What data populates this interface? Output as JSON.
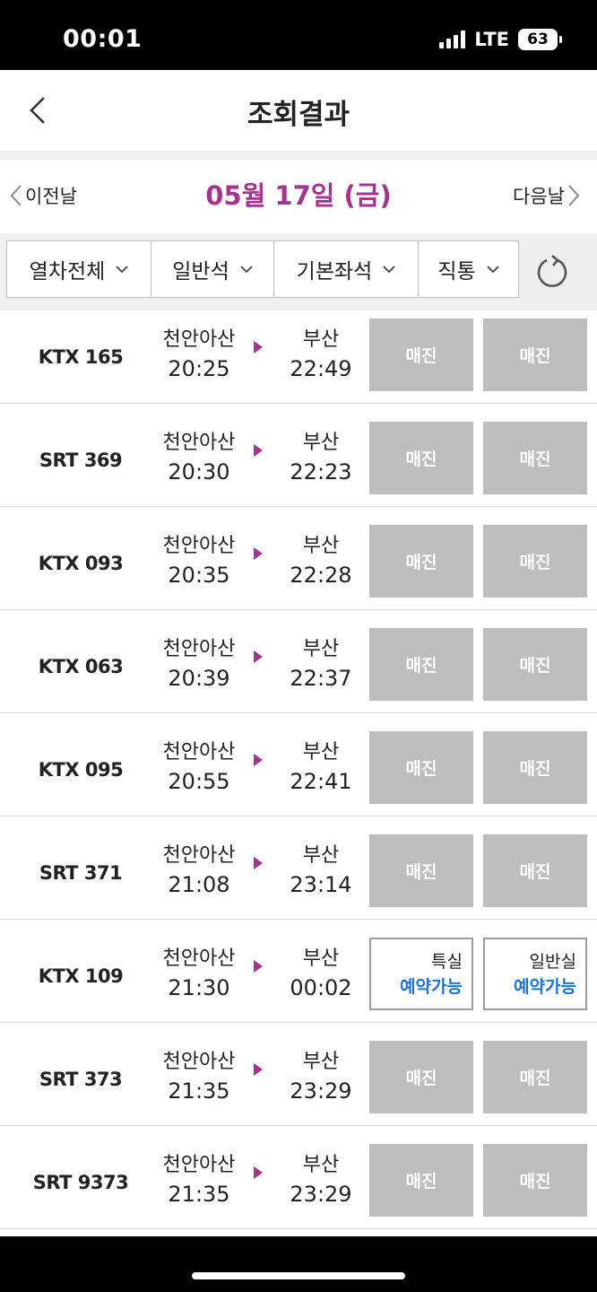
{
  "status": {
    "time": "00:01",
    "network": "LTE",
    "battery": "63"
  },
  "header": {
    "title": "조회결과",
    "back_icon": "chevron-left-icon"
  },
  "date_nav": {
    "prev_label": "이전날",
    "current_date": "05월 17일 (금)",
    "next_label": "다음날"
  },
  "filters": [
    {
      "label": "열차전체"
    },
    {
      "label": "일반석"
    },
    {
      "label": "기본좌석"
    },
    {
      "label": "직통"
    }
  ],
  "colors": {
    "accent": "#a3358f",
    "available": "#1a73d9",
    "soldout": "#bdbdbd"
  },
  "trains": [
    {
      "no": "KTX 165",
      "dep": "천안아산",
      "dep_time": "20:25",
      "arr": "부산",
      "arr_time": "22:49",
      "seat1": {
        "label": "매진",
        "status": "soldout"
      },
      "seat2": {
        "label": "매진",
        "status": "soldout"
      }
    },
    {
      "no": "SRT 369",
      "dep": "천안아산",
      "dep_time": "20:30",
      "arr": "부산",
      "arr_time": "22:23",
      "seat1": {
        "label": "매진",
        "status": "soldout"
      },
      "seat2": {
        "label": "매진",
        "status": "soldout"
      }
    },
    {
      "no": "KTX 093",
      "dep": "천안아산",
      "dep_time": "20:35",
      "arr": "부산",
      "arr_time": "22:28",
      "seat1": {
        "label": "매진",
        "status": "soldout"
      },
      "seat2": {
        "label": "매진",
        "status": "soldout"
      }
    },
    {
      "no": "KTX 063",
      "dep": "천안아산",
      "dep_time": "20:39",
      "arr": "부산",
      "arr_time": "22:37",
      "seat1": {
        "label": "매진",
        "status": "soldout"
      },
      "seat2": {
        "label": "매진",
        "status": "soldout"
      }
    },
    {
      "no": "KTX 095",
      "dep": "천안아산",
      "dep_time": "20:55",
      "arr": "부산",
      "arr_time": "22:41",
      "seat1": {
        "label": "매진",
        "status": "soldout"
      },
      "seat2": {
        "label": "매진",
        "status": "soldout"
      }
    },
    {
      "no": "SRT 371",
      "dep": "천안아산",
      "dep_time": "21:08",
      "arr": "부산",
      "arr_time": "23:14",
      "seat1": {
        "label": "매진",
        "status": "soldout"
      },
      "seat2": {
        "label": "매진",
        "status": "soldout"
      }
    },
    {
      "no": "KTX 109",
      "dep": "천안아산",
      "dep_time": "21:30",
      "arr": "부산",
      "arr_time": "00:02",
      "seat1": {
        "class": "특실",
        "label": "예약가능",
        "status": "available"
      },
      "seat2": {
        "class": "일반실",
        "label": "예약가능",
        "status": "available"
      }
    },
    {
      "no": "SRT 373",
      "dep": "천안아산",
      "dep_time": "21:35",
      "arr": "부산",
      "arr_time": "23:29",
      "seat1": {
        "label": "매진",
        "status": "soldout"
      },
      "seat2": {
        "label": "매진",
        "status": "soldout"
      }
    },
    {
      "no": "SRT 9373",
      "dep": "천안아산",
      "dep_time": "21:35",
      "arr": "부산",
      "arr_time": "23:29",
      "seat1": {
        "label": "매진",
        "status": "soldout"
      },
      "seat2": {
        "label": "매진",
        "status": "soldout"
      }
    }
  ]
}
